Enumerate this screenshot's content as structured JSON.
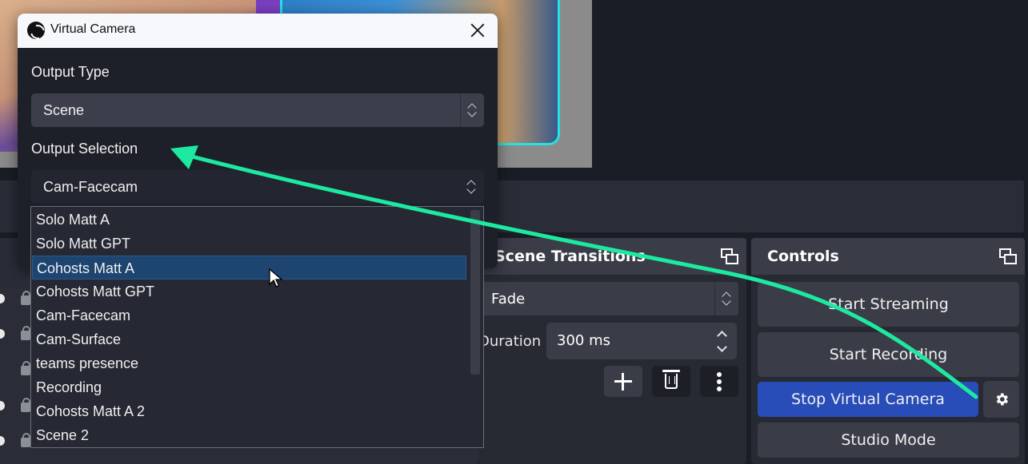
{
  "dialog": {
    "title": "Virtual Camera",
    "output_type_label": "Output Type",
    "output_type_value": "Scene",
    "output_selection_label": "Output Selection",
    "output_selection_value": "Cam-Facecam",
    "dropdown_options": [
      "Solo Matt A",
      "Solo Matt GPT",
      "Cohosts Matt A",
      "Cohosts Matt GPT",
      "Cam-Facecam",
      "Cam-Surface",
      "teams presence",
      "Recording",
      "Cohosts Matt A 2",
      "Scene 2"
    ],
    "highlighted_option": "Cohosts Matt A"
  },
  "transitions": {
    "title": "Scene Transitions",
    "transition_value": "Fade",
    "duration_label": "Duration",
    "duration_value": "300 ms"
  },
  "controls": {
    "title": "Controls",
    "start_streaming": "Start Streaming",
    "start_recording": "Start Recording",
    "stop_virtual_camera": "Stop Virtual Camera",
    "studio_mode": "Studio Mode"
  },
  "colors": {
    "annotation_arrow": "#1de9a0",
    "active_button": "#284cb8",
    "highlight": "#1d4570"
  }
}
